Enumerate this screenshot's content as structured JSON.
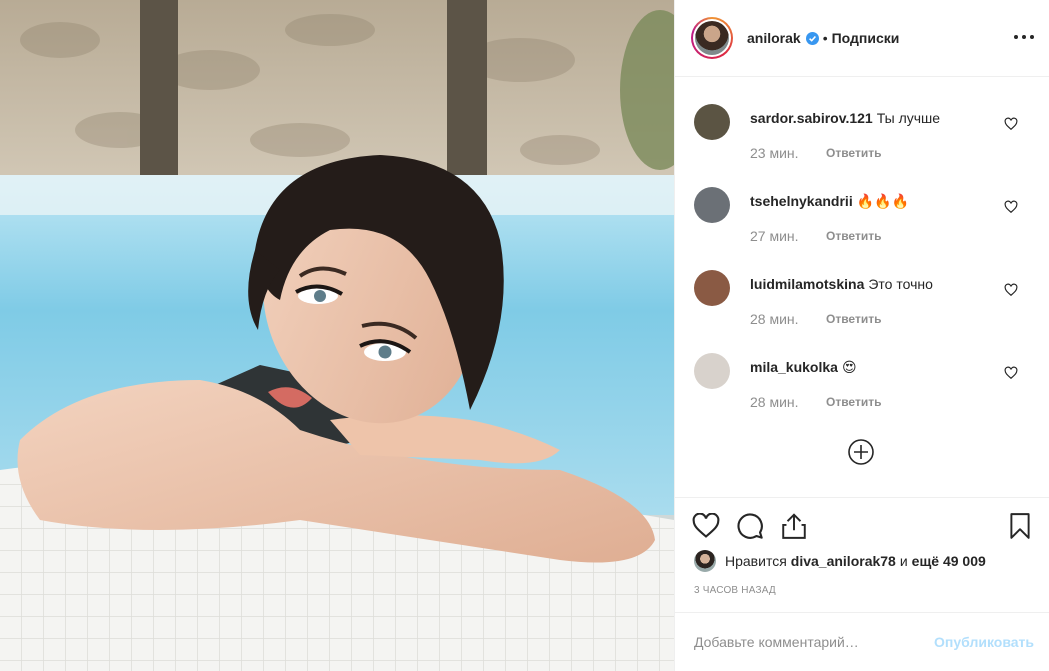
{
  "post": {
    "author": {
      "username": "anilorak",
      "verified": true,
      "separator": "•",
      "follow_state": "Подписки"
    },
    "photo": {
      "subject": "woman resting arms on pool edge"
    },
    "comments": [
      {
        "username": "sardor.sabirov.121",
        "text": "Ты лучше",
        "time": "23 мин.",
        "reply": "Ответить",
        "avatar_color": "#5b5443"
      },
      {
        "username": "tsehelnykandrii",
        "text": "🔥🔥🔥",
        "time": "27 мин.",
        "reply": "Ответить",
        "avatar_color": "#6b7076"
      },
      {
        "username": "luidmilamotskina",
        "text": "Это точно",
        "time": "28 мин.",
        "reply": "Ответить",
        "avatar_color": "#8a5a44"
      },
      {
        "username": "mila_kukolka",
        "text": "😍",
        "time": "28 мин.",
        "reply": "Ответить",
        "avatar_color": "#d8d2cc"
      }
    ],
    "likes": {
      "prefix": "Нравится",
      "liker": "diva_anilorak78",
      "conjunction": "и",
      "others": "ещё 49 009"
    },
    "time_ago": "3 часов назад",
    "add_comment": {
      "placeholder": "Добавьте комментарий…",
      "publish_label": "Опубликовать"
    }
  },
  "icons": {
    "header": [
      "verified-badge-icon",
      "more-options-icon"
    ],
    "actions": [
      "heart-icon",
      "comment-icon",
      "share-icon",
      "bookmark-icon"
    ],
    "comments": [
      "like-heart-icon",
      "load-more-plus-icon"
    ]
  },
  "colors": {
    "text": "#262626",
    "muted": "#8e8e8e",
    "verified": "#3897f0",
    "publish_disabled": "#b2dffc",
    "border": "#efefef"
  }
}
